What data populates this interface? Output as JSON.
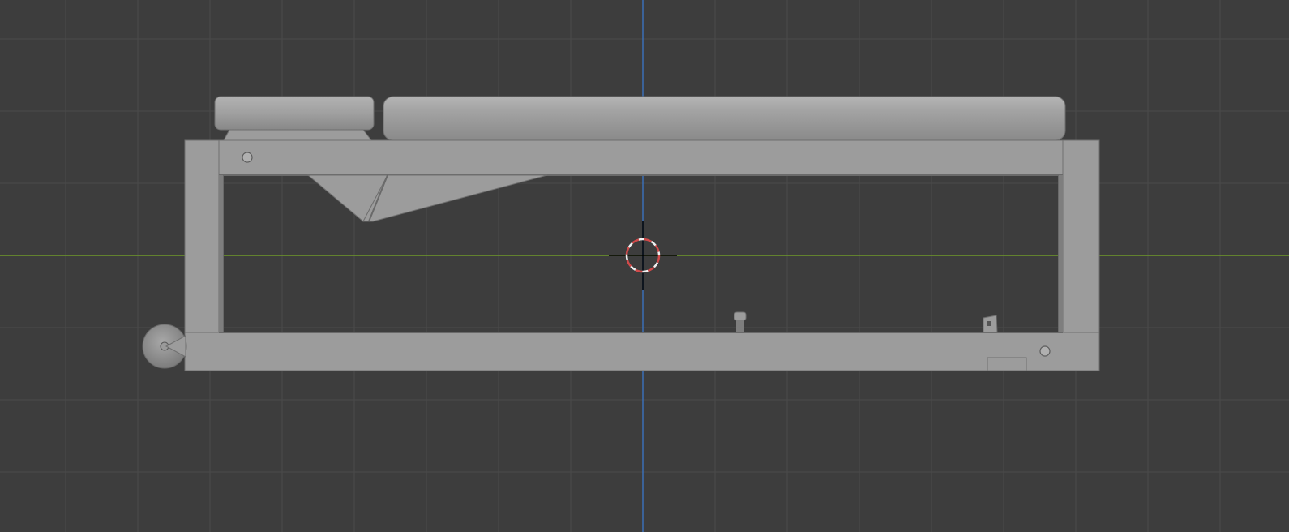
{
  "viewport": {
    "view": "orthographic-side",
    "background_color": "#3d3d3d",
    "grid": {
      "visible": true,
      "line_color": "#4a4a4a"
    },
    "axes": {
      "horizontal_axis_color": "#6e9a2a",
      "vertical_axis_color": "#3b6fb6"
    },
    "model": {
      "name": "cart-frame",
      "material_color": "#9c9c9c",
      "shade_dark": "#7e7e7e",
      "shade_light": "#b0b0b0"
    },
    "cursor_3d": {
      "icon": "3d-cursor-icon",
      "ring_color_a": "#d24a4a",
      "ring_color_b": "#f0f0f0"
    }
  }
}
